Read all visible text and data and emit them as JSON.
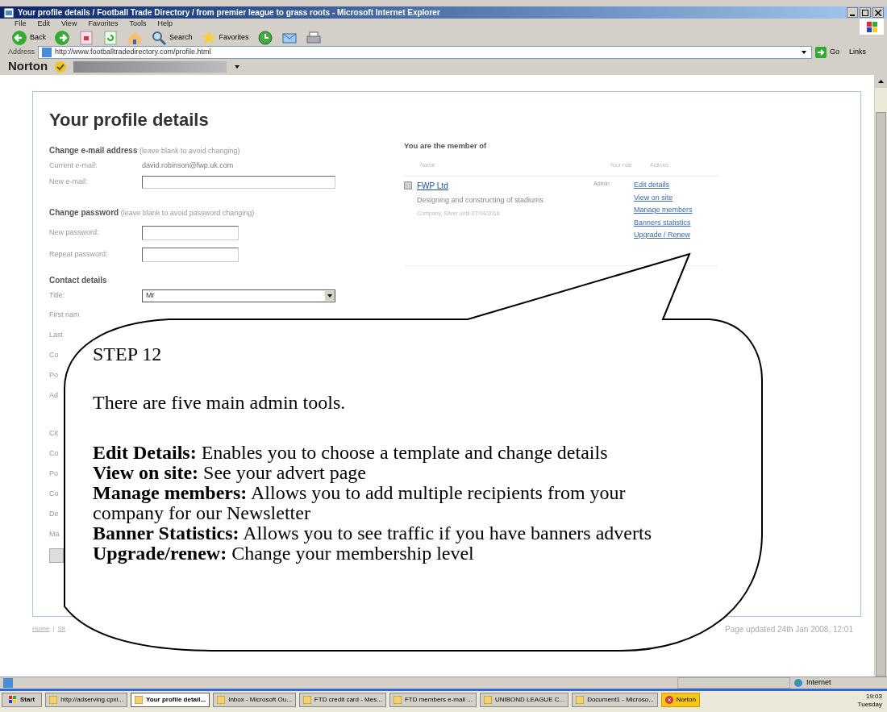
{
  "window": {
    "title": "Your profile details / Football Trade Directory / from premier league to grass roots - Microsoft Internet Explorer"
  },
  "menu": [
    "File",
    "Edit",
    "View",
    "Favorites",
    "Tools",
    "Help"
  ],
  "toolbar": [
    {
      "kind": "back",
      "label": "Back"
    },
    {
      "kind": "forward"
    },
    {
      "kind": "stop"
    },
    {
      "kind": "refresh"
    },
    {
      "kind": "home"
    },
    {
      "kind": "search",
      "label": "Search"
    },
    {
      "kind": "favorites",
      "label": "Favorites"
    },
    {
      "kind": "history"
    },
    {
      "kind": "mail"
    },
    {
      "kind": "print"
    }
  ],
  "address": {
    "label": "Address",
    "value": "http://www.footballtradedirectory.com/profile.html",
    "go": "Go",
    "links": "Links"
  },
  "norton": {
    "brand": "Norton"
  },
  "page": {
    "heading": "Your profile details",
    "email": {
      "title": "Change e-mail address",
      "hint": "(leave blank to avoid changing)",
      "current_label": "Current e-mail:",
      "current_value": "david.robinson@fwp.uk.com",
      "new_label": "New e-mail:"
    },
    "password": {
      "title": "Change password",
      "hint": "(leave blank to avoid password changing)",
      "fields": [
        "New password:",
        "Repeat password:"
      ]
    },
    "contact": {
      "title": "Contact details",
      "title_label": "Title:",
      "title_value": "Mr",
      "partial_labels": [
        "First nam",
        "Last",
        "Co",
        "Po",
        "Ad",
        "Cit",
        "Co",
        "Po",
        "Co",
        "De",
        "Ma"
      ]
    },
    "membership": {
      "title": "You are the member of",
      "columns": [
        "Name",
        "Your role",
        "Actions"
      ],
      "rows": [
        {
          "name": "FWP Ltd",
          "description": "Designing and constructing of stadiums",
          "meta": "Company, Silver until 07/04/2018",
          "role": "Admin",
          "actions": [
            "Edit details",
            "View on site",
            "Manage members",
            "Banners statistics",
            "Upgrade / Renew"
          ]
        }
      ]
    },
    "footer": {
      "links": [
        "Home",
        "Sit"
      ],
      "separator": "|",
      "updated": "Page updated 24th Jan 2008, 12:01"
    }
  },
  "callout": {
    "title": "STEP 12",
    "intro": "There are five main admin tools.",
    "items": [
      "**Edit Details:** Enables you to choose a template and change details",
      "**View on site:** See your advert page",
      "**Manage members:** Allows you to add multiple recipients from your company for our Newsletter",
      "**Banner Statistics:** Allows you to see traffic if you have banners adverts",
      "**Upgrade/renew:** Change your membership level"
    ]
  },
  "status_bar": {
    "zone": "Internet"
  },
  "taskbar": {
    "start": "Start",
    "items": [
      {
        "label": "http://adserving.cpxi...",
        "selected": false
      },
      {
        "label": "Your profile detail...",
        "selected": true
      },
      {
        "label": "Inbox - Microsoft Ou...",
        "selected": false
      },
      {
        "label": "FTD credit card - Mes...",
        "selected": false
      },
      {
        "label": "FTD members e-mail ...",
        "selected": false
      },
      {
        "label": "UNIBOND LEAGUE C...",
        "selected": false
      },
      {
        "label": "Document1 - Microso...",
        "selected": false
      },
      {
        "label": "Norton",
        "selected": false
      }
    ],
    "time": "19:03",
    "day": "Tuesday"
  }
}
